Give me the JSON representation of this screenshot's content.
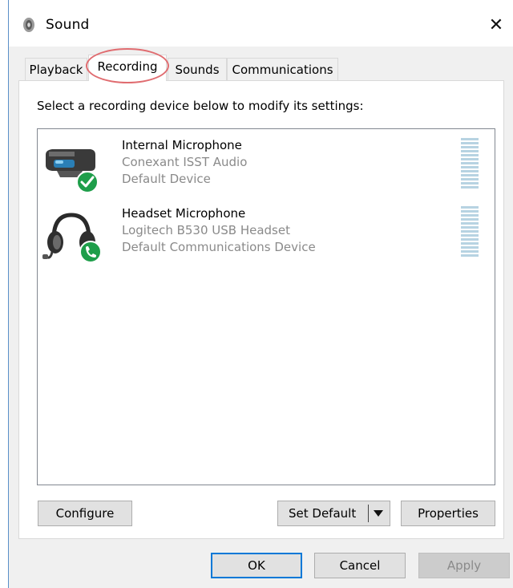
{
  "window": {
    "title": "Sound",
    "close_glyph": "✕",
    "title_icon": "speaker-icon"
  },
  "tabs": [
    {
      "label": "Playback",
      "active": false
    },
    {
      "label": "Recording",
      "active": true
    },
    {
      "label": "Sounds",
      "active": false
    },
    {
      "label": "Communications",
      "active": false
    }
  ],
  "panel": {
    "instruction": "Select a recording device below to modify its settings:"
  },
  "devices": [
    {
      "name": "Internal Microphone",
      "driver": "Conexant ISST Audio",
      "status": "Default Device",
      "icon": "webcam-microphone-icon",
      "badge": "default-check-icon"
    },
    {
      "name": "Headset Microphone",
      "driver": "Logitech B530 USB Headset",
      "status": "Default Communications Device",
      "icon": "headset-icon",
      "badge": "communications-phone-icon"
    }
  ],
  "panel_buttons": {
    "configure": "Configure",
    "set_default": "Set Default",
    "properties": "Properties"
  },
  "dialog_buttons": {
    "ok": "OK",
    "cancel": "Cancel",
    "apply": "Apply"
  },
  "colors": {
    "accent_blue": "#0078d7",
    "badge_green": "#1e9e4a",
    "highlight_red": "#e06c70",
    "meter": "#b7d3e2"
  }
}
